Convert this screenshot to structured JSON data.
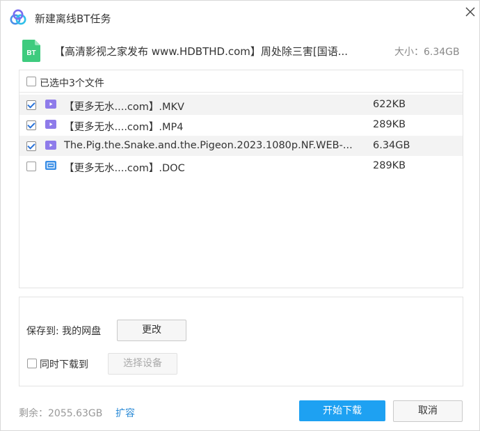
{
  "window": {
    "title": "新建离线BT任务",
    "close_icon": "close-icon"
  },
  "task": {
    "name": "【高清影视之家发布 www.HDBTHD.com】周处除三害[国语...",
    "size": "大小：6.34GB",
    "icon": "bt-file-icon",
    "icon_color": "#3ecb7e"
  },
  "file_list": {
    "selected_label": "已选中3个文件",
    "header_checked": false,
    "files": [
      {
        "name": "【更多无水....com】.MKV",
        "size": "622KB",
        "checked": true,
        "icon": "video-file-icon"
      },
      {
        "name": "【更多无水....com】.MP4",
        "size": "289KB",
        "checked": true,
        "icon": "video-file-icon"
      },
      {
        "name": "The.Pig.the.Snake.and.the.Pigeon.2023.1080p.NF.WEB-...",
        "size": "6.34GB",
        "checked": true,
        "icon": "video-file-icon"
      },
      {
        "name": "【更多无水....com】.DOC",
        "size": "289KB",
        "checked": false,
        "icon": "document-file-icon"
      }
    ]
  },
  "save": {
    "label": "保存到: 我的网盘",
    "change_button": "更改",
    "sync_label": "同时下载到",
    "sync_checked": false,
    "device_button": "选择设备"
  },
  "footer": {
    "remaining": "剩余：2055.63GB",
    "expand_link": "扩容",
    "start_button": "开始下载",
    "cancel_button": "取消"
  },
  "colors": {
    "accent": "#1ea1f2",
    "link": "#2a8ad6",
    "video_icon": "#8e7bea",
    "doc_icon": "#3a8ee6",
    "bt_icon": "#3ecb7e"
  }
}
